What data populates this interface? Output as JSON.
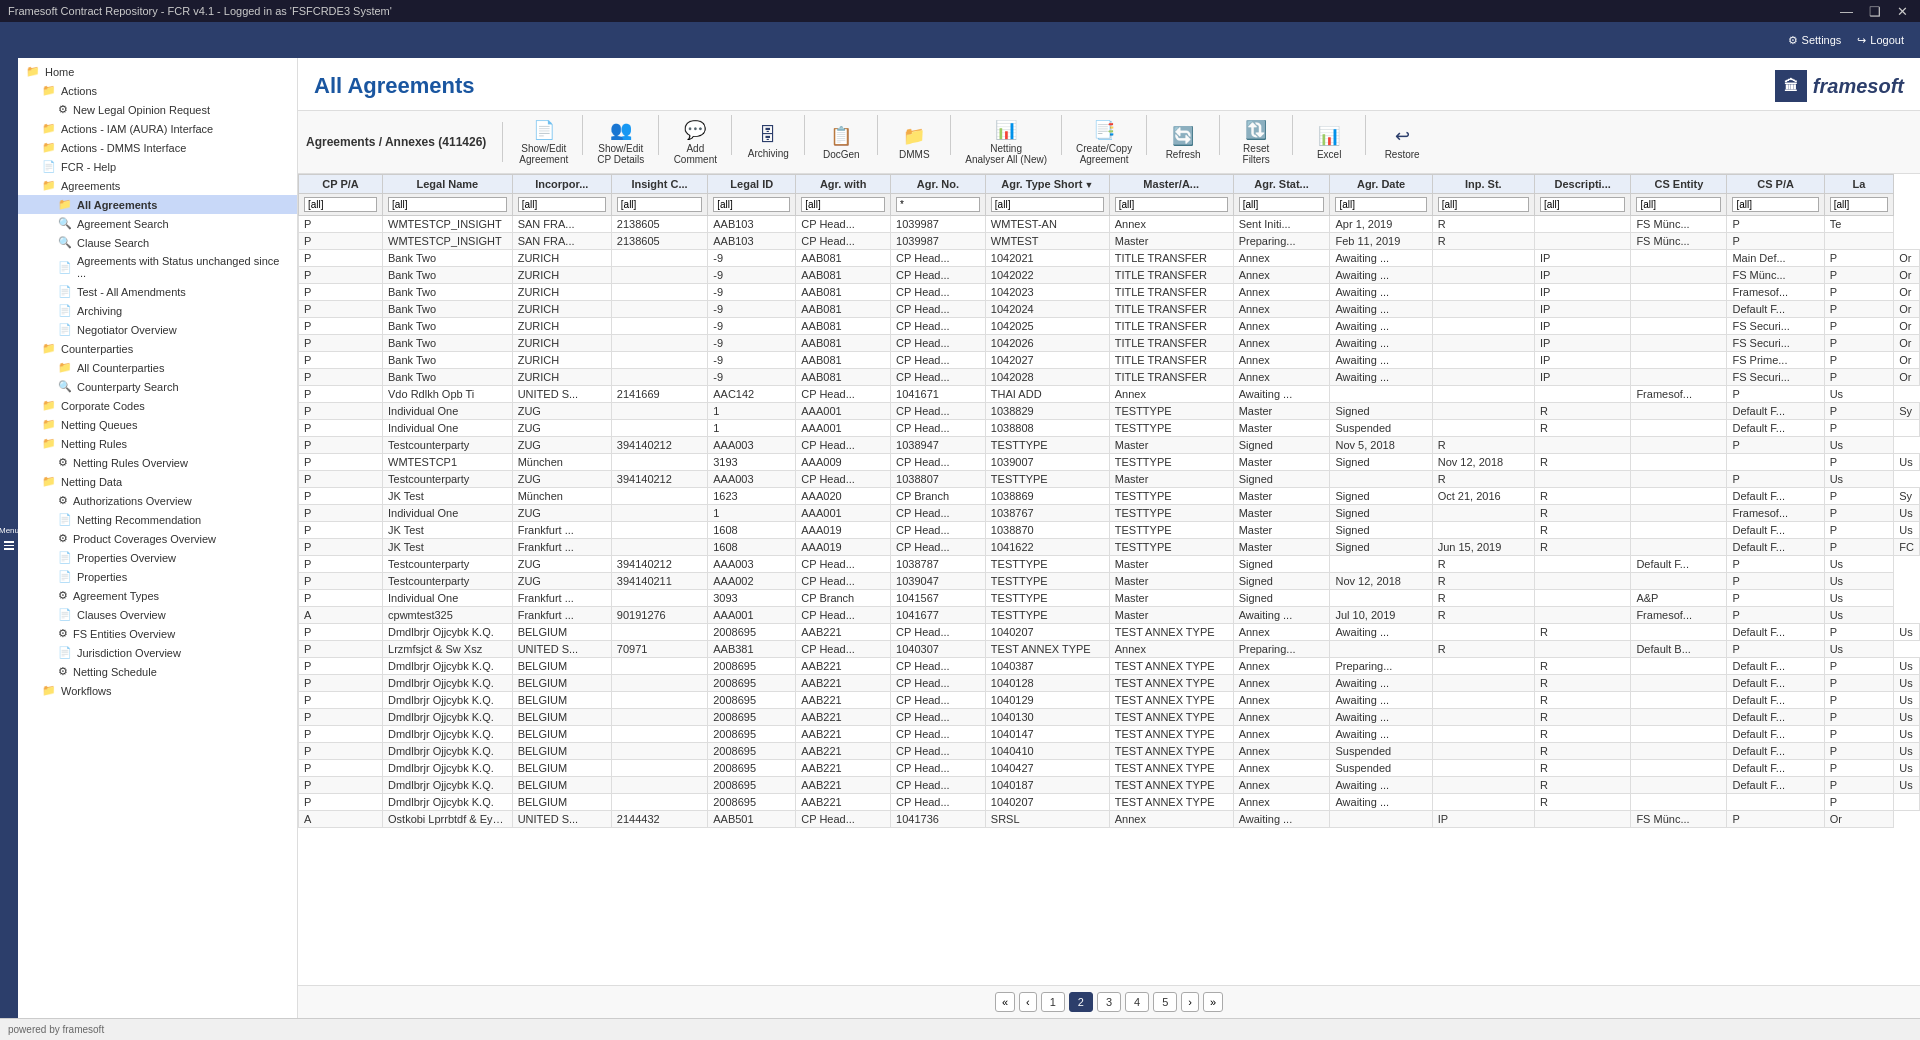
{
  "titleBar": {
    "title": "Framesoft Contract Repository - FCR v4.1 - Logged in as 'FSFCRDE3 System'",
    "minBtn": "—",
    "maxBtn": "❑",
    "closeBtn": "✕"
  },
  "topBar": {
    "settingsLabel": "Settings",
    "logoutLabel": "Logout"
  },
  "pageHeader": {
    "title": "All Agreements",
    "logoText": "framesoft"
  },
  "sidebar": {
    "items": [
      {
        "id": "home",
        "label": "Home",
        "indent": 0,
        "type": "folder"
      },
      {
        "id": "actions",
        "label": "Actions",
        "indent": 1,
        "type": "folder"
      },
      {
        "id": "new-legal",
        "label": "New Legal Opinion Request",
        "indent": 2,
        "type": "gear"
      },
      {
        "id": "actions-iam",
        "label": "Actions - IAM (AURA) Interface",
        "indent": 1,
        "type": "folder"
      },
      {
        "id": "actions-dmms",
        "label": "Actions - DMMS Interface",
        "indent": 1,
        "type": "folder"
      },
      {
        "id": "fcr-help",
        "label": "FCR - Help",
        "indent": 1,
        "type": "doc"
      },
      {
        "id": "agreements",
        "label": "Agreements",
        "indent": 1,
        "type": "folder"
      },
      {
        "id": "all-agreements",
        "label": "All Agreements",
        "indent": 2,
        "type": "folder",
        "active": true
      },
      {
        "id": "agreement-search",
        "label": "Agreement Search",
        "indent": 2,
        "type": "search"
      },
      {
        "id": "clause-search",
        "label": "Clause Search",
        "indent": 2,
        "type": "search"
      },
      {
        "id": "agreements-status",
        "label": "Agreements with Status unchanged since ...",
        "indent": 2,
        "type": "doc"
      },
      {
        "id": "test-all-amendments",
        "label": "Test - All Amendments",
        "indent": 2,
        "type": "doc"
      },
      {
        "id": "archiving",
        "label": "Archiving",
        "indent": 2,
        "type": "doc"
      },
      {
        "id": "negotiator-overview",
        "label": "Negotiator Overview",
        "indent": 2,
        "type": "doc"
      },
      {
        "id": "counterparties",
        "label": "Counterparties",
        "indent": 1,
        "type": "folder"
      },
      {
        "id": "all-counterparties",
        "label": "All Counterparties",
        "indent": 2,
        "type": "folder"
      },
      {
        "id": "counterparty-search",
        "label": "Counterparty Search",
        "indent": 2,
        "type": "search"
      },
      {
        "id": "corporate-codes",
        "label": "Corporate Codes",
        "indent": 1,
        "type": "folder"
      },
      {
        "id": "netting-queues",
        "label": "Netting Queues",
        "indent": 1,
        "type": "folder"
      },
      {
        "id": "netting-rules",
        "label": "Netting Rules",
        "indent": 1,
        "type": "folder"
      },
      {
        "id": "netting-rules-overview",
        "label": "Netting Rules Overview",
        "indent": 2,
        "type": "gear"
      },
      {
        "id": "netting-data",
        "label": "Netting Data",
        "indent": 1,
        "type": "folder"
      },
      {
        "id": "authorizations-overview",
        "label": "Authorizations Overview",
        "indent": 2,
        "type": "gear"
      },
      {
        "id": "netting-recommendation",
        "label": "Netting Recommendation",
        "indent": 2,
        "type": "doc"
      },
      {
        "id": "product-coverages",
        "label": "Product Coverages Overview",
        "indent": 2,
        "type": "gear"
      },
      {
        "id": "properties-overview",
        "label": "Properties Overview",
        "indent": 2,
        "type": "doc"
      },
      {
        "id": "properties",
        "label": "Properties",
        "indent": 2,
        "type": "doc"
      },
      {
        "id": "agreement-types",
        "label": "Agreement Types",
        "indent": 2,
        "type": "gear"
      },
      {
        "id": "clauses-overview",
        "label": "Clauses Overview",
        "indent": 2,
        "type": "doc"
      },
      {
        "id": "fs-entities-overview",
        "label": "FS Entities Overview",
        "indent": 2,
        "type": "gear"
      },
      {
        "id": "jurisdiction-overview",
        "label": "Jurisdiction Overview",
        "indent": 2,
        "type": "doc"
      },
      {
        "id": "netting-schedule",
        "label": "Netting Schedule",
        "indent": 2,
        "type": "gear"
      },
      {
        "id": "workflows",
        "label": "Workflows",
        "indent": 1,
        "type": "folder"
      }
    ]
  },
  "toolbar": {
    "title": "Agreements / Annexes",
    "count": "(411426)",
    "buttons": [
      {
        "id": "show-edit-agreement",
        "label": "Show/Edit\nAgreement",
        "icon": "📄"
      },
      {
        "id": "show-edit-cp-details",
        "label": "Show/Edit\nCP Details",
        "icon": "👥"
      },
      {
        "id": "add-comment",
        "label": "Add\nComment",
        "icon": "💬"
      },
      {
        "id": "archiving",
        "label": "Archiving",
        "icon": "🗄"
      },
      {
        "id": "docgen",
        "label": "DocGen",
        "icon": "📋"
      },
      {
        "id": "dmms",
        "label": "DMMS",
        "icon": "📁"
      },
      {
        "id": "netting-analyser",
        "label": "Netting\nAnalyser All (New)",
        "icon": "📊"
      },
      {
        "id": "create-copy-agreement",
        "label": "Create/Copy\nAgreement",
        "icon": "📑"
      },
      {
        "id": "refresh",
        "label": "Refresh",
        "icon": "🔄"
      },
      {
        "id": "reset-filters",
        "label": "Reset\nFilters",
        "icon": "🔃"
      },
      {
        "id": "excel",
        "label": "Excel",
        "icon": "📊"
      },
      {
        "id": "restore",
        "label": "Restore",
        "icon": "↩"
      }
    ]
  },
  "table": {
    "columns": [
      {
        "id": "cp-pa",
        "label": "CP P/A",
        "filter": "[all]"
      },
      {
        "id": "legal-name",
        "label": "Legal Name",
        "filter": "[all]"
      },
      {
        "id": "incorpor",
        "label": "Incorpor...",
        "filter": "[all]"
      },
      {
        "id": "insight-c",
        "label": "Insight C...",
        "filter": "[all]"
      },
      {
        "id": "legal-id",
        "label": "Legal ID",
        "filter": "[all]"
      },
      {
        "id": "agr-with",
        "label": "Agr. with",
        "filter": "[all]"
      },
      {
        "id": "agr-no",
        "label": "Agr. No.",
        "filter": "*"
      },
      {
        "id": "agr-type-short",
        "label": "Agr. Type Short",
        "filter": "[all]",
        "sorted": true
      },
      {
        "id": "master-a",
        "label": "Master/A...",
        "filter": "[all]"
      },
      {
        "id": "agr-stat",
        "label": "Agr. Stat...",
        "filter": "[all]"
      },
      {
        "id": "agr-date",
        "label": "Agr. Date",
        "filter": "[all]"
      },
      {
        "id": "inp-st",
        "label": "Inp. St.",
        "filter": "[all]"
      },
      {
        "id": "descripti",
        "label": "Descripti...",
        "filter": "[all]"
      },
      {
        "id": "cs-entity",
        "label": "CS Entity",
        "filter": "[all]"
      },
      {
        "id": "cs-pa",
        "label": "CS P/A",
        "filter": "[all]"
      },
      {
        "id": "la",
        "label": "La",
        "filter": "[all]"
      }
    ],
    "rows": [
      [
        "P",
        "WMTESTCP_INSIGHT",
        "SAN FRA...",
        "2138605",
        "AAB103",
        "CP Head...",
        "1039987",
        "WMTEST-AN",
        "Annex",
        "Sent Initi...",
        "Apr 1, 2019",
        "R",
        "",
        "FS Münc...",
        "P",
        "Te"
      ],
      [
        "P",
        "WMTESTCP_INSIGHT",
        "SAN FRA...",
        "2138605",
        "AAB103",
        "CP Head...",
        "1039987",
        "WMTEST",
        "Master",
        "Preparing...",
        "Feb 11, 2019",
        "R",
        "",
        "FS Münc...",
        "P",
        ""
      ],
      [
        "P",
        "Bank Two",
        "ZURICH",
        "",
        "-9",
        "AAB081",
        "CP Head...",
        "1042021",
        "TITLE TRANSFER",
        "Annex",
        "Awaiting ...",
        "",
        "IP",
        "",
        "Main Def...",
        "P",
        "Or"
      ],
      [
        "P",
        "Bank Two",
        "ZURICH",
        "",
        "-9",
        "AAB081",
        "CP Head...",
        "1042022",
        "TITLE TRANSFER",
        "Annex",
        "Awaiting ...",
        "",
        "IP",
        "",
        "FS Münc...",
        "P",
        "Or"
      ],
      [
        "P",
        "Bank Two",
        "ZURICH",
        "",
        "-9",
        "AAB081",
        "CP Head...",
        "1042023",
        "TITLE TRANSFER",
        "Annex",
        "Awaiting ...",
        "",
        "IP",
        "",
        "Framesof...",
        "P",
        "Or"
      ],
      [
        "P",
        "Bank Two",
        "ZURICH",
        "",
        "-9",
        "AAB081",
        "CP Head...",
        "1042024",
        "TITLE TRANSFER",
        "Annex",
        "Awaiting ...",
        "",
        "IP",
        "",
        "Default F...",
        "P",
        "Or"
      ],
      [
        "P",
        "Bank Two",
        "ZURICH",
        "",
        "-9",
        "AAB081",
        "CP Head...",
        "1042025",
        "TITLE TRANSFER",
        "Annex",
        "Awaiting ...",
        "",
        "IP",
        "",
        "FS Securi...",
        "P",
        "Or"
      ],
      [
        "P",
        "Bank Two",
        "ZURICH",
        "",
        "-9",
        "AAB081",
        "CP Head...",
        "1042026",
        "TITLE TRANSFER",
        "Annex",
        "Awaiting ...",
        "",
        "IP",
        "",
        "FS Securi...",
        "P",
        "Or"
      ],
      [
        "P",
        "Bank Two",
        "ZURICH",
        "",
        "-9",
        "AAB081",
        "CP Head...",
        "1042027",
        "TITLE TRANSFER",
        "Annex",
        "Awaiting ...",
        "",
        "IP",
        "",
        "FS Prime...",
        "P",
        "Or"
      ],
      [
        "P",
        "Bank Two",
        "ZURICH",
        "",
        "-9",
        "AAB081",
        "CP Head...",
        "1042028",
        "TITLE TRANSFER",
        "Annex",
        "Awaiting ...",
        "",
        "IP",
        "",
        "FS Securi...",
        "P",
        "Or"
      ],
      [
        "P",
        "Vdo Rdlkh Opb Ti",
        "UNITED S...",
        "2141669",
        "AAC142",
        "CP Head...",
        "1041671",
        "THAI ADD",
        "Annex",
        "Awaiting ...",
        "",
        "",
        "",
        "Framesof...",
        "P",
        "Us"
      ],
      [
        "P",
        "Individual One",
        "ZUG",
        "",
        "1",
        "AAA001",
        "CP Head...",
        "1038829",
        "TESTTYPE",
        "Master",
        "Signed",
        "",
        "R",
        "",
        "Default F...",
        "P",
        "Sy"
      ],
      [
        "P",
        "Individual One",
        "ZUG",
        "",
        "1",
        "AAA001",
        "CP Head...",
        "1038808",
        "TESTTYPE",
        "Master",
        "Suspended",
        "",
        "R",
        "",
        "Default F...",
        "P",
        ""
      ],
      [
        "P",
        "Testcounterparty",
        "ZUG",
        "394140212",
        "AAA003",
        "CP Head...",
        "1038947",
        "TESTTYPE",
        "Master",
        "Signed",
        "Nov 5, 2018",
        "R",
        "",
        "",
        "P",
        "Us"
      ],
      [
        "P",
        "WMTESTCP1",
        "München",
        "",
        "3193",
        "AAA009",
        "CP Head...",
        "1039007",
        "TESTTYPE",
        "Master",
        "Signed",
        "Nov 12, 2018",
        "R",
        "",
        "",
        "P",
        "Us"
      ],
      [
        "P",
        "Testcounterparty",
        "ZUG",
        "394140212",
        "AAA003",
        "CP Head...",
        "1038807",
        "TESTTYPE",
        "Master",
        "Signed",
        "",
        "R",
        "",
        "",
        "P",
        "Us"
      ],
      [
        "P",
        "JK Test",
        "München",
        "",
        "1623",
        "AAA020",
        "CP Branch",
        "1038869",
        "TESTTYPE",
        "Master",
        "Signed",
        "Oct 21, 2016",
        "R",
        "",
        "Default F...",
        "P",
        "Sy"
      ],
      [
        "P",
        "Individual One",
        "ZUG",
        "",
        "1",
        "AAA001",
        "CP Head...",
        "1038767",
        "TESTTYPE",
        "Master",
        "Signed",
        "",
        "R",
        "",
        "Framesof...",
        "P",
        "Us"
      ],
      [
        "P",
        "JK Test",
        "Frankfurt ...",
        "",
        "1608",
        "AAA019",
        "CP Head...",
        "1038870",
        "TESTTYPE",
        "Master",
        "Signed",
        "",
        "R",
        "",
        "Default F...",
        "P",
        "Us"
      ],
      [
        "P",
        "JK Test",
        "Frankfurt ...",
        "",
        "1608",
        "AAA019",
        "CP Head...",
        "1041622",
        "TESTTYPE",
        "Master",
        "Signed",
        "Jun 15, 2019",
        "R",
        "",
        "Default F...",
        "P",
        "FC"
      ],
      [
        "P",
        "Testcounterparty",
        "ZUG",
        "394140212",
        "AAA003",
        "CP Head...",
        "1038787",
        "TESTTYPE",
        "Master",
        "Signed",
        "",
        "R",
        "",
        "Default F...",
        "P",
        "Us"
      ],
      [
        "P",
        "Testcounterparty",
        "ZUG",
        "394140211",
        "AAA002",
        "CP Head...",
        "1039047",
        "TESTTYPE",
        "Master",
        "Signed",
        "Nov 12, 2018",
        "R",
        "",
        "",
        "P",
        "Us"
      ],
      [
        "P",
        "Individual One",
        "Frankfurt ...",
        "",
        "3093",
        "CP Branch",
        "1041567",
        "TESTTYPE",
        "Master",
        "Signed",
        "",
        "R",
        "",
        "A&P",
        "P",
        "Us"
      ],
      [
        "A",
        "cpwmtest325",
        "Frankfurt ...",
        "90191276",
        "AAA001",
        "CP Head...",
        "1041677",
        "TESTTYPE",
        "Master",
        "Awaiting ...",
        "Jul 10, 2019",
        "R",
        "",
        "Framesof...",
        "P",
        "Us"
      ],
      [
        "P",
        "Dmdlbrjr Ojjcybk K.Q.",
        "BELGIUM",
        "",
        "2008695",
        "AAB221",
        "CP Head...",
        "1040207",
        "TEST ANNEX TYPE",
        "Annex",
        "Awaiting ...",
        "",
        "R",
        "",
        "Default F...",
        "P",
        "Us"
      ],
      [
        "P",
        "Lrzmfsjct & Sw Xsz",
        "UNITED S...",
        "70971",
        "AAB381",
        "CP Head...",
        "1040307",
        "TEST ANNEX TYPE",
        "Annex",
        "Preparing...",
        "",
        "R",
        "",
        "Default B...",
        "P",
        "Us"
      ],
      [
        "P",
        "Dmdlbrjr Ojjcybk K.Q.",
        "BELGIUM",
        "",
        "2008695",
        "AAB221",
        "CP Head...",
        "1040387",
        "TEST ANNEX TYPE",
        "Annex",
        "Preparing...",
        "",
        "R",
        "",
        "Default F...",
        "P",
        "Us"
      ],
      [
        "P",
        "Dmdlbrjr Ojjcybk K.Q.",
        "BELGIUM",
        "",
        "2008695",
        "AAB221",
        "CP Head...",
        "1040128",
        "TEST ANNEX TYPE",
        "Annex",
        "Awaiting ...",
        "",
        "R",
        "",
        "Default F...",
        "P",
        "Us"
      ],
      [
        "P",
        "Dmdlbrjr Ojjcybk K.Q.",
        "BELGIUM",
        "",
        "2008695",
        "AAB221",
        "CP Head...",
        "1040129",
        "TEST ANNEX TYPE",
        "Annex",
        "Awaiting ...",
        "",
        "R",
        "",
        "Default F...",
        "P",
        "Us"
      ],
      [
        "P",
        "Dmdlbrjr Ojjcybk K.Q.",
        "BELGIUM",
        "",
        "2008695",
        "AAB221",
        "CP Head...",
        "1040130",
        "TEST ANNEX TYPE",
        "Annex",
        "Awaiting ...",
        "",
        "R",
        "",
        "Default F...",
        "P",
        "Us"
      ],
      [
        "P",
        "Dmdlbrjr Ojjcybk K.Q.",
        "BELGIUM",
        "",
        "2008695",
        "AAB221",
        "CP Head...",
        "1040147",
        "TEST ANNEX TYPE",
        "Annex",
        "Awaiting ...",
        "",
        "R",
        "",
        "Default F...",
        "P",
        "Us"
      ],
      [
        "P",
        "Dmdlbrjr Ojjcybk K.Q.",
        "BELGIUM",
        "",
        "2008695",
        "AAB221",
        "CP Head...",
        "1040410",
        "TEST ANNEX TYPE",
        "Annex",
        "Suspended",
        "",
        "R",
        "",
        "Default F...",
        "P",
        "Us"
      ],
      [
        "P",
        "Dmdlbrjr Ojjcybk K.Q.",
        "BELGIUM",
        "",
        "2008695",
        "AAB221",
        "CP Head...",
        "1040427",
        "TEST ANNEX TYPE",
        "Annex",
        "Suspended",
        "",
        "R",
        "",
        "Default F...",
        "P",
        "Us"
      ],
      [
        "P",
        "Dmdlbrjr Ojjcybk K.Q.",
        "BELGIUM",
        "",
        "2008695",
        "AAB221",
        "CP Head...",
        "1040187",
        "TEST ANNEX TYPE",
        "Annex",
        "Awaiting ...",
        "",
        "R",
        "",
        "Default F...",
        "P",
        "Us"
      ],
      [
        "P",
        "Dmdlbrjr Ojjcybk K.Q.",
        "BELGIUM",
        "",
        "2008695",
        "AAB221",
        "CP Head...",
        "1040207",
        "TEST ANNEX TYPE",
        "Annex",
        "Awaiting ...",
        "",
        "R",
        "",
        "",
        "P",
        ""
      ],
      [
        "A",
        "Ostkobi Lprrbtdf & Eyoztrlfjpf Hzs",
        "UNITED S...",
        "2144432",
        "AAB501",
        "CP Head...",
        "1041736",
        "SRSL",
        "Annex",
        "Awaiting ...",
        "",
        "IP",
        "",
        "FS Münc...",
        "P",
        "Or"
      ]
    ]
  },
  "pagination": {
    "pages": [
      "1",
      "2",
      "3",
      "4",
      "5"
    ],
    "currentPage": 2,
    "prevBtn": "‹",
    "nextBtn": "›",
    "firstBtn": "«",
    "lastBtn": "»"
  },
  "statusBar": {
    "text": "powered by framesoft"
  }
}
